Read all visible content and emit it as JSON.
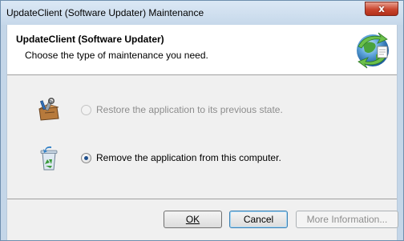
{
  "window": {
    "title": "UpdateClient (Software Updater) Maintenance",
    "close_symbol": "x"
  },
  "header": {
    "title": "UpdateClient (Software Updater)",
    "subtitle": "Choose the type of maintenance you need.",
    "icon": "installer-globe-icon"
  },
  "options": [
    {
      "label": "Restore the application to its previous state.",
      "icon": "repair-toolbox-icon",
      "enabled": false,
      "selected": false
    },
    {
      "label": "Remove the application from this computer.",
      "icon": "recycle-bin-icon",
      "enabled": true,
      "selected": true
    }
  ],
  "buttons": {
    "ok": "OK",
    "cancel": "Cancel",
    "more_info": "More Information..."
  },
  "colors": {
    "frame": "#c4d6e8",
    "close_red": "#c9452e",
    "radio_dot": "#1e4f8c"
  }
}
